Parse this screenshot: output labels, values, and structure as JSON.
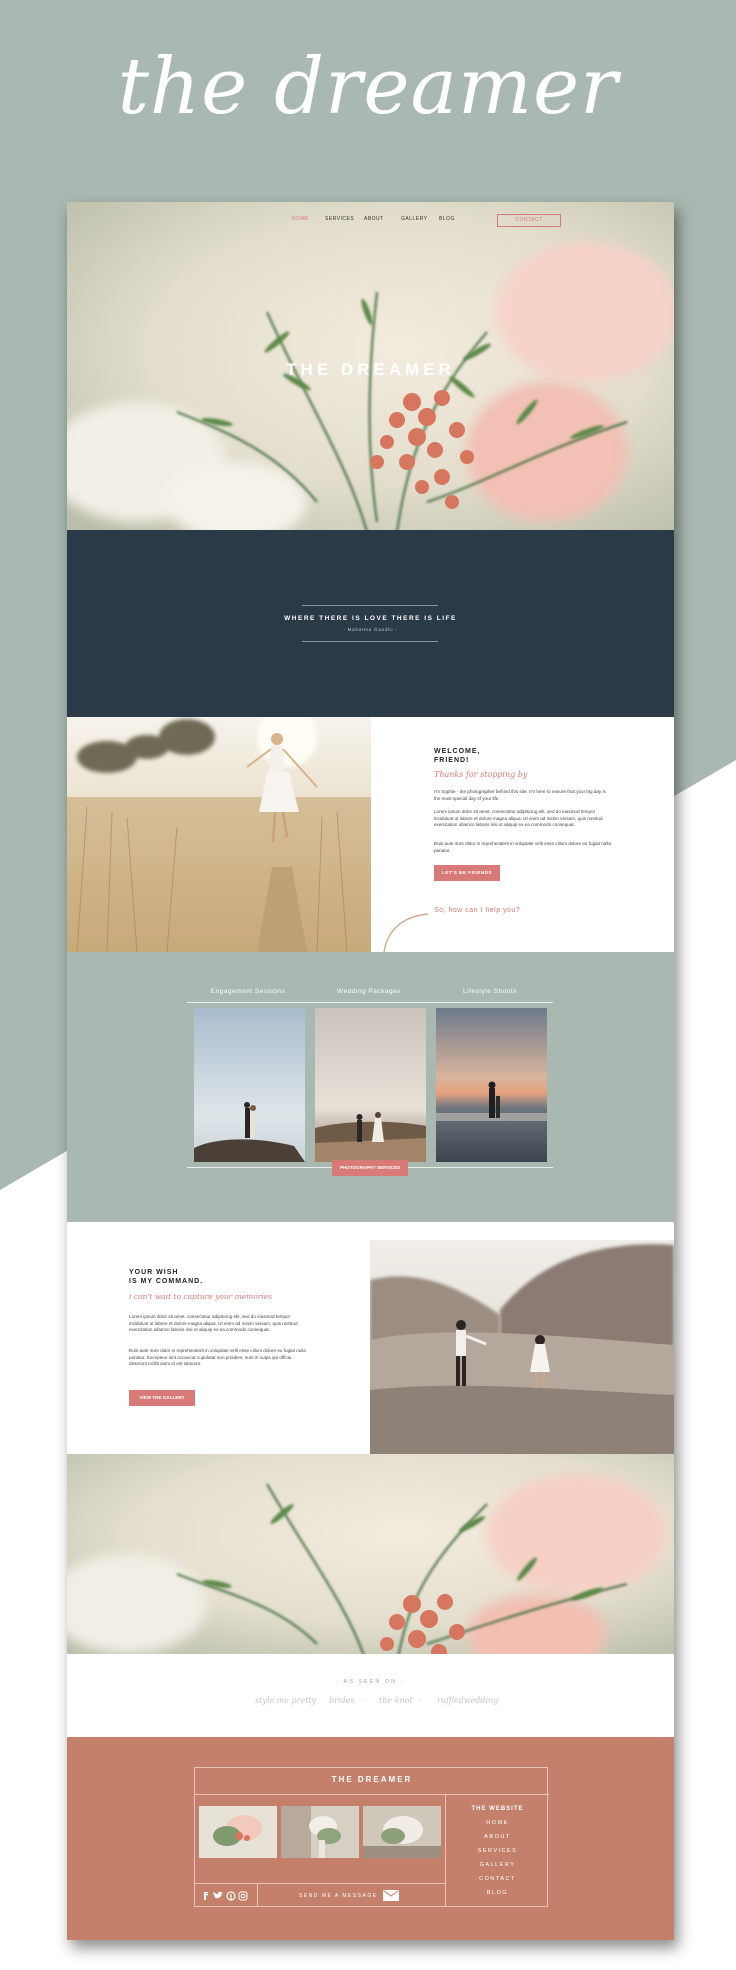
{
  "header": {
    "title": "the dreamer"
  },
  "nav": {
    "items": [
      {
        "label": "HOME",
        "active": true
      },
      {
        "label": "SERVICES",
        "active": false
      },
      {
        "label": "ABOUT",
        "active": false
      },
      {
        "label": "GALLERY",
        "active": false
      },
      {
        "label": "BLOG",
        "active": false
      }
    ],
    "contact_label": "CONTACT"
  },
  "hero": {
    "title": "THE DREAMER"
  },
  "quote": {
    "text": "WHERE THERE IS LOVE THERE IS LIFE",
    "attribution": "- Mahatma Gandhi -"
  },
  "welcome": {
    "heading_line1": "WELCOME,",
    "heading_line2": "FRIEND!",
    "script": "Thanks for stopping by",
    "para1": "I'm Sophie - the photographer behind this site. I'm here to ensure that your big day is the most special day of your life.",
    "para2": "Lorem ipsum dolor sit amet, consectetur adipiscing elit, sed do eiusmod tempor incididunt ut labore et dolore magna aliqua. Ut enim ad minim veniam, quis nostrud exercitation ullamco laboris nisi ut aliquip ex ea commodo consequat.",
    "para3": "Duis aute irure dolor in reprehenderit in voluptate velit esse cillum dolore eu fugiat nulla pariatur.",
    "button": "LET'S BE FRIENDS",
    "help": "So, how can I help you?"
  },
  "services": {
    "labels": [
      "Engagement Sessions",
      "Wedding Packages",
      "Lifestyle Shoots"
    ],
    "button": "PHOTOGRAPHY SERVICES"
  },
  "wish": {
    "heading_line1": "YOUR WISH",
    "heading_line2": "IS MY COMMAND.",
    "script": "i can't wait to capture your memories",
    "para1": "Lorem ipsum dolor sit amet, consectetur adipiscing elit, sed do eiusmod tempor incididunt ut labore et dolore magna aliqua. Ut enim ad minim veniam, quis nostrud exercitation ullamco laboris nisi ut aliquip ex ea commodo consequat.",
    "para2": "Duis aute irure dolor in reprehenderit in voluptate velit esse cillum dolore eu fugiat nulla pariatur. Excepteur sint occaecat cupidatat non proident, sunt in culpa qui officia deserunt mollit anim id est laborum.",
    "button": "VIEW THE GALLERY"
  },
  "seen": {
    "heading": "- AS SEEN ON -",
    "logos": [
      "style me pretty",
      "brides",
      "the knot",
      "ruffled",
      "ruffledwedding"
    ],
    "separators": [
      "·",
      "·",
      "·"
    ]
  },
  "footer": {
    "title": "THE DREAMER",
    "nav_heading": "THE WEBSITE",
    "nav": [
      "HOME",
      "ABOUT",
      "SERVICES",
      "GALLERY",
      "CONTACT",
      "BLOG"
    ],
    "message": "SEND ME A MESSAGE",
    "social_icons": [
      "facebook-icon",
      "twitter-icon",
      "pinterest-icon",
      "instagram-icon"
    ]
  },
  "colors": {
    "sage": "#a9b8b1",
    "navy": "#2b3a47",
    "coral": "#d87a78",
    "terracotta": "#c4806a"
  }
}
